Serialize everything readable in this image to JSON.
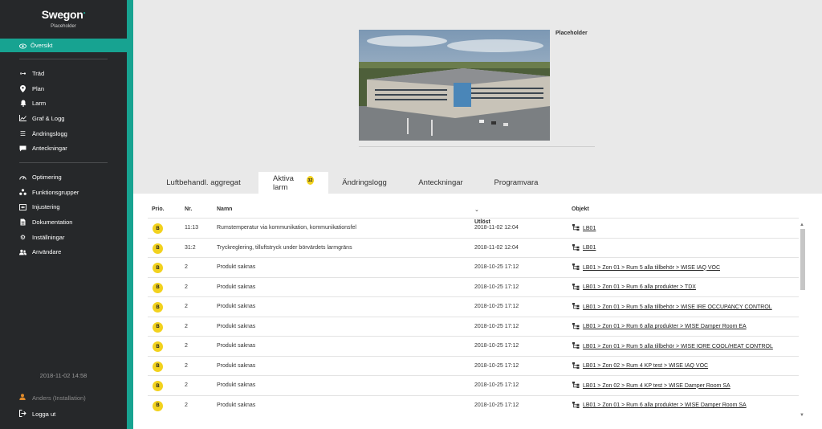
{
  "sidebar": {
    "logo": "Swegon",
    "subtitle": "Placeholder",
    "active_item": {
      "label": "Översikt",
      "icon": "eye-icon"
    },
    "group1": [
      {
        "label": "Träd",
        "icon": "tree-icon"
      },
      {
        "label": "Plan",
        "icon": "pin-icon"
      },
      {
        "label": "Larm",
        "icon": "bell-icon"
      },
      {
        "label": "Graf & Logg",
        "icon": "graph-icon"
      },
      {
        "label": "Ändringslogg",
        "icon": "list-icon"
      },
      {
        "label": "Anteckningar",
        "icon": "note-icon"
      }
    ],
    "group2": [
      {
        "label": "Optimering",
        "icon": "gauge-icon"
      },
      {
        "label": "Funktionsgrupper",
        "icon": "groups-icon"
      },
      {
        "label": "Injustering",
        "icon": "adjust-icon"
      },
      {
        "label": "Dokumentation",
        "icon": "document-icon"
      },
      {
        "label": "Inställningar",
        "icon": "gear-icon"
      },
      {
        "label": "Användare",
        "icon": "users-icon"
      }
    ],
    "date": "2018-11-02 14:58",
    "user": "Anders (Installation)",
    "logout": "Logga ut"
  },
  "hero": {
    "caption": "Placeholder"
  },
  "tabs": [
    {
      "label": "Luftbehandl. aggregat"
    },
    {
      "label": "Aktiva larm",
      "badge": "32"
    },
    {
      "label": "Ändringslogg"
    },
    {
      "label": "Anteckningar"
    },
    {
      "label": "Programvara"
    }
  ],
  "table": {
    "headers": {
      "prio": "Prio.",
      "nr": "Nr.",
      "name": "Namn",
      "trigger": "Utlöst",
      "object": "Objekt"
    },
    "sort_indicator": "chevron-down-icon",
    "rows": [
      {
        "prio": "B",
        "nr": "11:13",
        "name": "Rumstemperatur via kommunikation, kommunikationsfel",
        "time": "2018-11-02 12:04",
        "object": "LB01"
      },
      {
        "prio": "B",
        "nr": "31:2",
        "name": "Tryckreglering, tilluftstryck under börvärdets larmgräns",
        "time": "2018-11-02 12:04",
        "object": "LB01"
      },
      {
        "prio": "B",
        "nr": "2",
        "name": "Produkt saknas",
        "time": "2018-10-25 17:12",
        "object": "LB01 > Zon 01 > Rum 5 alla tillbehör > WISE IAQ VOC"
      },
      {
        "prio": "B",
        "nr": "2",
        "name": "Produkt saknas",
        "time": "2018-10-25 17:12",
        "object": "LB01 > Zon 01 > Rum 6 alla produkter > TDX"
      },
      {
        "prio": "B",
        "nr": "2",
        "name": "Produkt saknas",
        "time": "2018-10-25 17:12",
        "object": "LB01 > Zon 01 > Rum 5 alla tillbehör > WISE IRE OCCUPANCY CONTROL"
      },
      {
        "prio": "B",
        "nr": "2",
        "name": "Produkt saknas",
        "time": "2018-10-25 17:12",
        "object": "LB01 > Zon 01 > Rum 6 alla produkter > WISE Damper Room EA"
      },
      {
        "prio": "B",
        "nr": "2",
        "name": "Produkt saknas",
        "time": "2018-10-25 17:12",
        "object": "LB01 > Zon 01 > Rum 5 alla tillbehör > WISE IORE COOL/HEAT CONTROL"
      },
      {
        "prio": "B",
        "nr": "2",
        "name": "Produkt saknas",
        "time": "2018-10-25 17:12",
        "object": "LB01 > Zon 02 > Rum 4 KP test > WISE IAQ VOC"
      },
      {
        "prio": "B",
        "nr": "2",
        "name": "Produkt saknas",
        "time": "2018-10-25 17:12",
        "object": "LB01 > Zon 02 > Rum 4 KP test > WISE Damper Room SA"
      },
      {
        "prio": "B",
        "nr": "2",
        "name": "Produkt saknas",
        "time": "2018-10-25 17:12",
        "object": "LB01 > Zon 01 > Rum 6 alla produkter > WISE Damper Room SA"
      }
    ]
  },
  "colors": {
    "accent": "#17a391",
    "sidebar": "#26282a",
    "badge": "#f2d21e"
  }
}
